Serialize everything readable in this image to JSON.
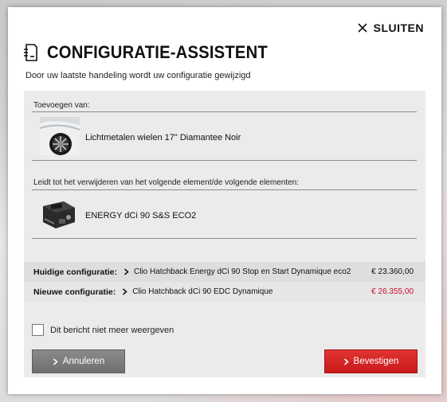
{
  "dialog": {
    "close_label": "SLUITEN",
    "title": "CONFIGURATIE-ASSISTENT",
    "subtitle": "Door uw laatste handeling wordt uw configuratie gewijzigd"
  },
  "add_section": {
    "label": "Toevoegen van:",
    "item_name": "Lichtmetalen wielen 17\" Diamantee Noir",
    "item_icon": "wheel-thumbnail"
  },
  "remove_section": {
    "label": "Leidt tot het verwijderen van het volgende element/de volgende elementen:",
    "item_name": "ENERGY dCi 90 S&S ECO2",
    "item_icon": "engine-thumbnail"
  },
  "current_config": {
    "label": "Huidige configuratie:",
    "model": "Clio Hatchback Energy dCi 90 Stop en Start Dynamique eco2",
    "price": "€ 23.360,00"
  },
  "new_config": {
    "label": "Nieuwe configuratie:",
    "model": "Clio Hatchback dCi 90 EDC Dynamique",
    "price": "€ 26.355,00",
    "price_color": "#c8102e"
  },
  "options": {
    "dont_show_label": "Dit bericht niet meer weergeven",
    "dont_show_checked": false
  },
  "buttons": {
    "cancel_label": "Annuleren",
    "confirm_label": "Bevestigen",
    "confirm_color": "#d42020",
    "cancel_color": "#7a7a7a"
  }
}
